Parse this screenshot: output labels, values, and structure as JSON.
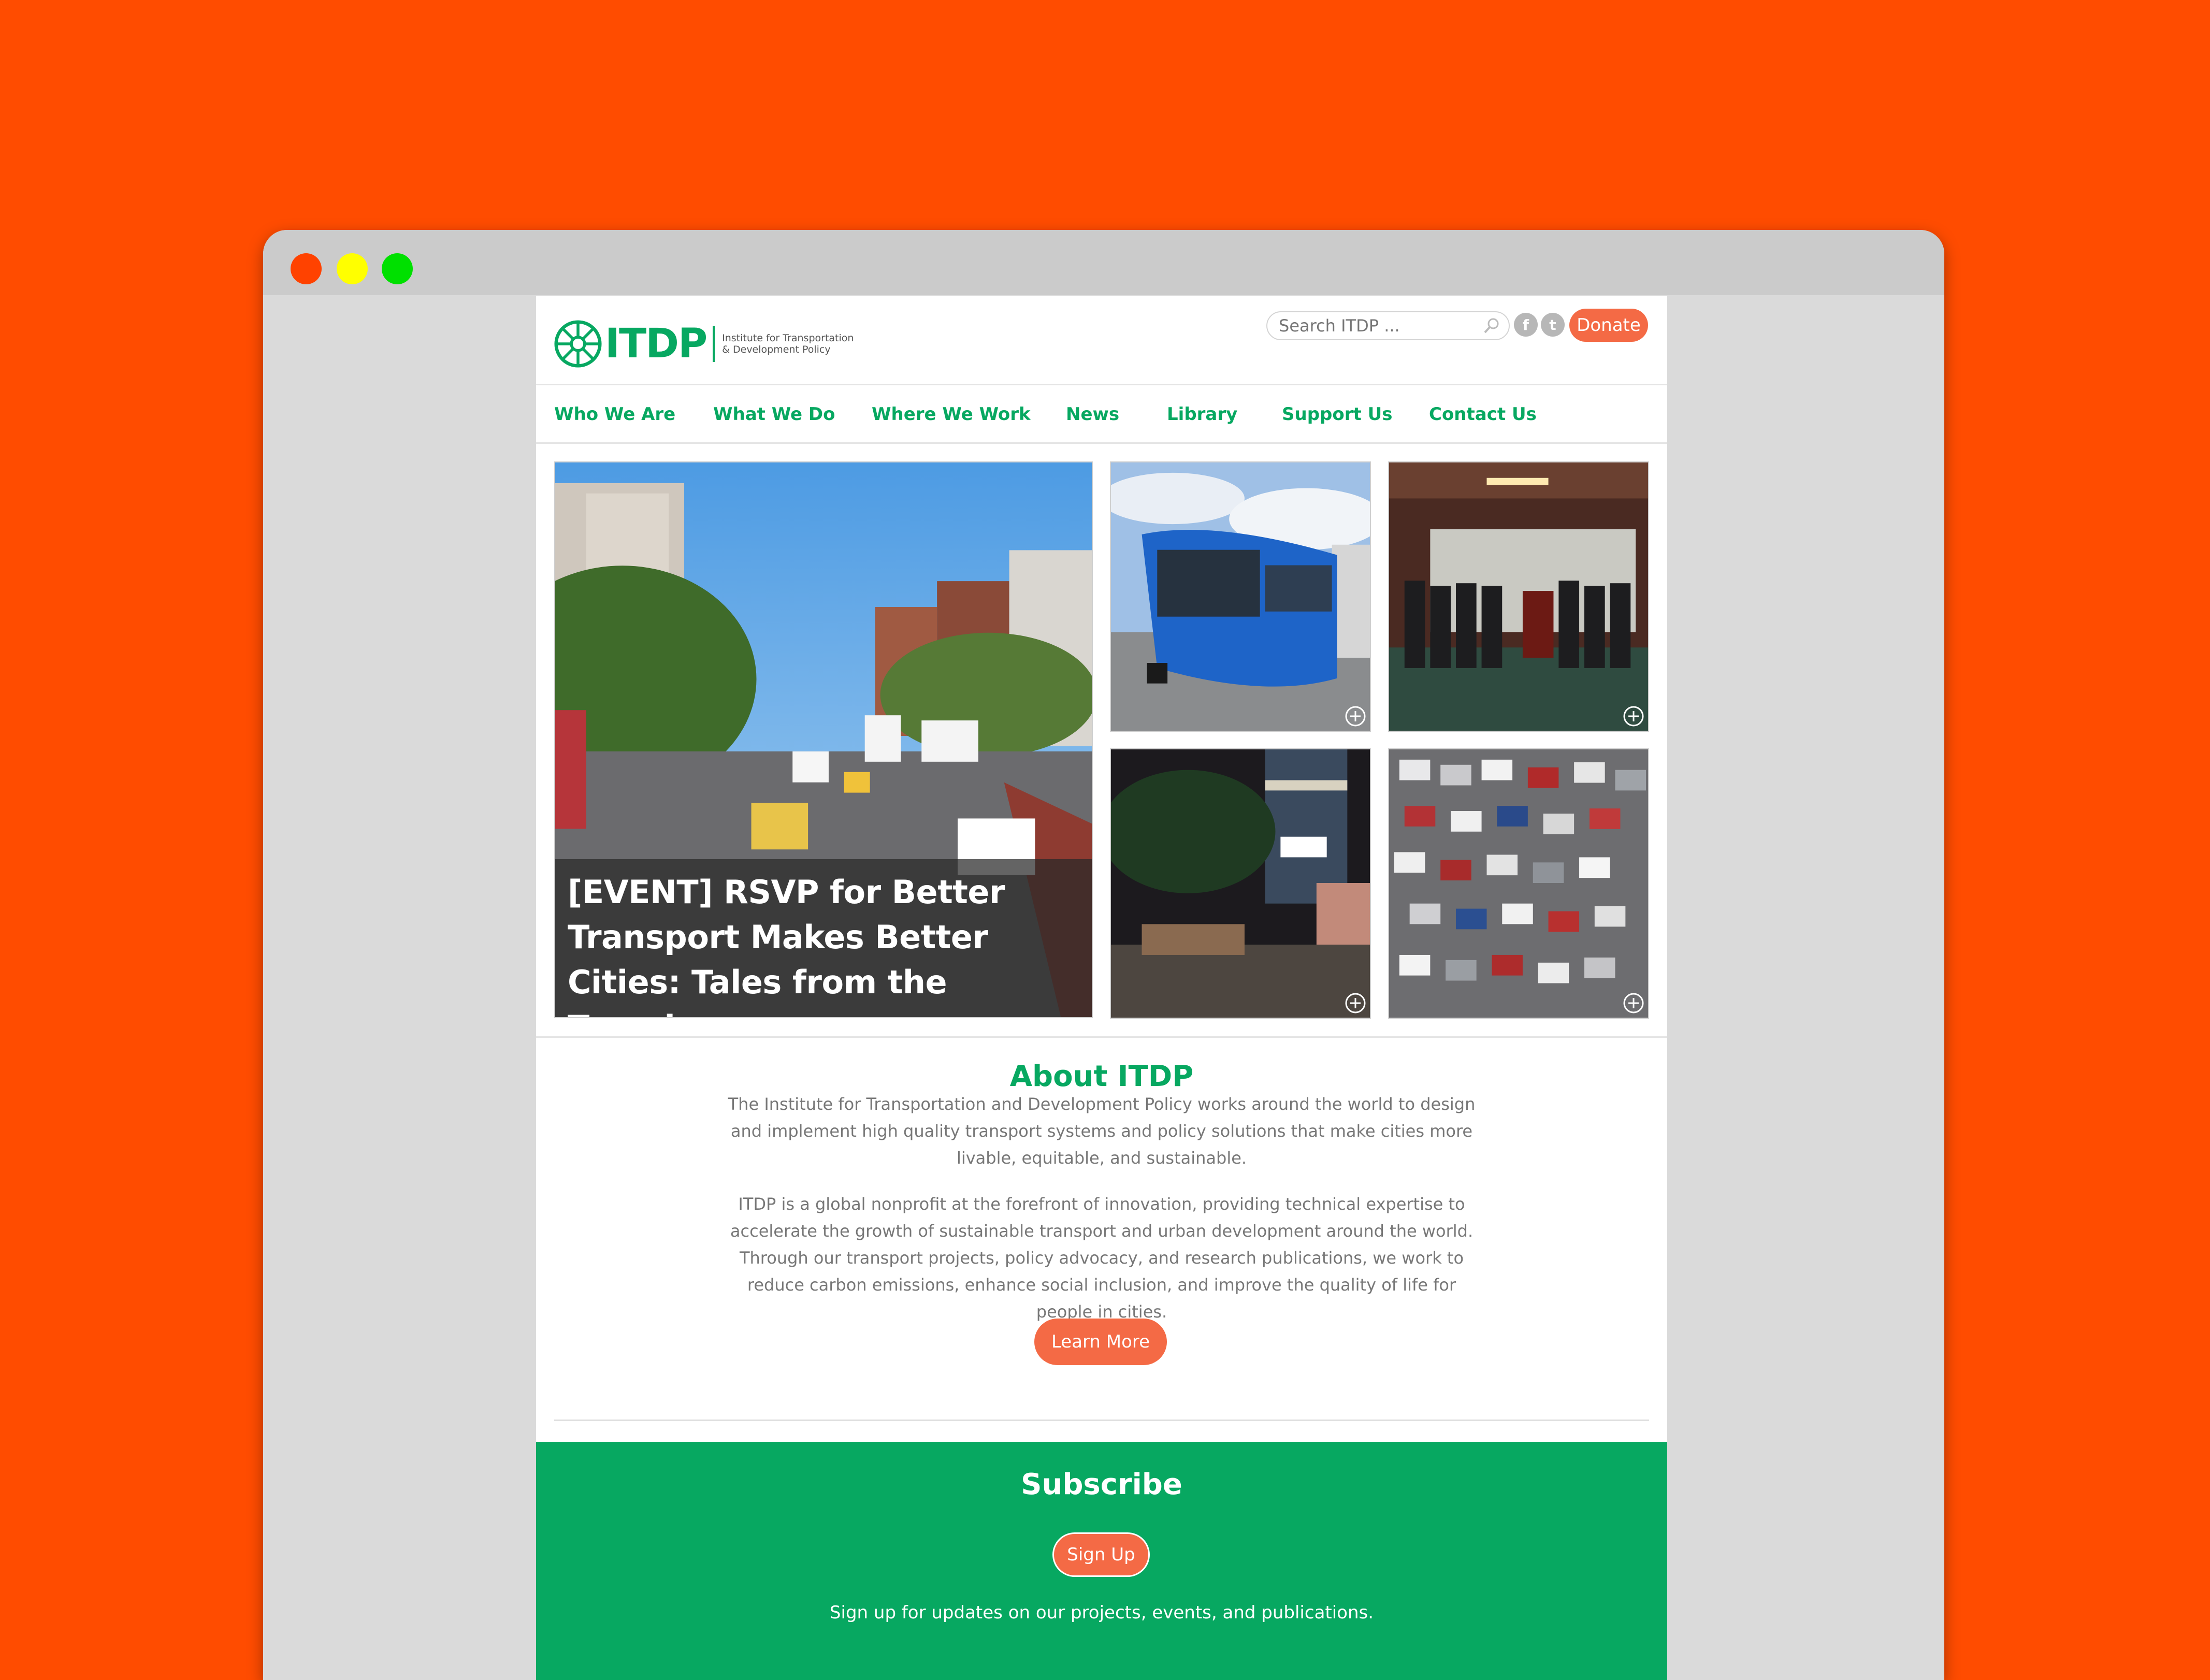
{
  "colors": {
    "background": "#ff4c00",
    "brand_green": "#07a861",
    "accent_orange": "#f46a45",
    "window_chrome": "#cbcbcb"
  },
  "logo": {
    "name": "ITDP",
    "subtitle": "Institute for Transportation & Development Policy",
    "icon": "itdp-star-logo-icon"
  },
  "header": {
    "search_placeholder": "Search ITDP ...",
    "facebook_glyph": "f",
    "twitter_glyph": "t",
    "donate_label": "Donate"
  },
  "nav": {
    "items": [
      {
        "label": "Who We Are"
      },
      {
        "label": "What We Do"
      },
      {
        "label": "Where We Work"
      },
      {
        "label": "News"
      },
      {
        "label": "Library"
      },
      {
        "label": "Support Us"
      },
      {
        "label": "Contact Us"
      }
    ]
  },
  "hero": {
    "title": "[EVENT] RSVP for Better Transport Makes Better Cities: Tales from the Trenches"
  },
  "about": {
    "title": "About ITDP",
    "paragraph1": "The Institute for Transportation and Development Policy works around the world to design and implement high quality transport systems and policy solutions that make cities more livable, equitable, and sustainable.",
    "paragraph2": "ITDP is a global nonprofit at the forefront of innovation, providing technical expertise to accelerate the growth of sustainable transport and urban development around the world. Through our transport projects, policy advocacy, and research publications, we work to reduce carbon emissions, enhance social inclusion, and improve the quality of life for people in cities.",
    "button_label": "Learn More"
  },
  "subscribe": {
    "title": "Subscribe",
    "button_label": "Sign Up",
    "text": "Sign up for updates on our projects, events, and publications."
  }
}
